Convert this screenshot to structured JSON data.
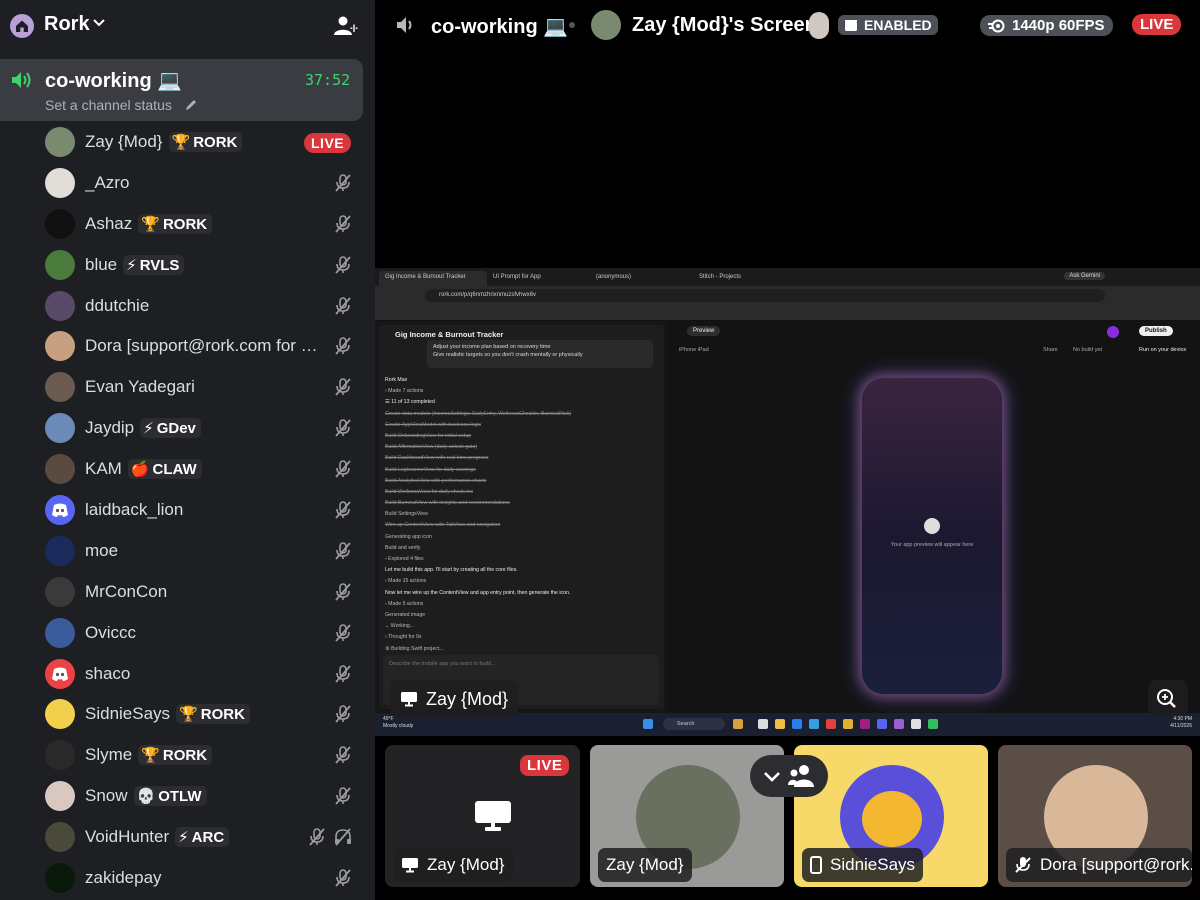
{
  "server": {
    "name": "Rork",
    "icon": "home-house-icon"
  },
  "voice_channel": {
    "name": "co-working 💻",
    "timer": "37:52",
    "status_placeholder": "Set a channel status"
  },
  "members": [
    {
      "name": "Zay {Mod}",
      "tag_icon": "🏆",
      "tag": "RORK",
      "live": "LIVE",
      "avatar_color": "#7a8a70"
    },
    {
      "name": "_Azro",
      "tag_icon": "",
      "tag": "",
      "avatar_color": "#e0ddd6"
    },
    {
      "name": "Ashaz",
      "tag_icon": "🏆",
      "tag": "RORK",
      "avatar_color": "#111111"
    },
    {
      "name": "blue",
      "tag_icon": "⚡",
      "tag": "RVLS",
      "avatar_color": "#4a7a3c"
    },
    {
      "name": "ddutchie",
      "tag_icon": "",
      "tag": "",
      "avatar_color": "#5a4a6a"
    },
    {
      "name": "Dora [support@rork.com for help]",
      "tag_icon": "",
      "tag": "",
      "avatar_color": "#c8a080"
    },
    {
      "name": "Evan Yadegari",
      "tag_icon": "",
      "tag": "",
      "avatar_color": "#6a5a50"
    },
    {
      "name": "Jaydip",
      "tag_icon": "⚡",
      "tag": "GDev",
      "avatar_color": "#6a8ab8"
    },
    {
      "name": "KAM",
      "tag_icon": "🍎",
      "tag": "CLAW",
      "avatar_color": "#5a4a40"
    },
    {
      "name": "laidback_lion",
      "tag_icon": "",
      "tag": "",
      "avatar_color": "#5865f2",
      "default_avatar": true
    },
    {
      "name": "moe",
      "tag_icon": "",
      "tag": "",
      "avatar_color": "#1a2a5a"
    },
    {
      "name": "MrConCon",
      "tag_icon": "",
      "tag": "",
      "avatar_color": "#3a3a3a"
    },
    {
      "name": "Oviccc",
      "tag_icon": "",
      "tag": "",
      "avatar_color": "#3a5a9a"
    },
    {
      "name": "shaco",
      "tag_icon": "",
      "tag": "",
      "avatar_color": "#ed4245",
      "default_avatar": true
    },
    {
      "name": "SidnieSays",
      "tag_icon": "🏆",
      "tag": "RORK",
      "avatar_color": "#f2d04c"
    },
    {
      "name": "Slyme",
      "tag_icon": "🏆",
      "tag": "RORK",
      "avatar_color": "#2a2a2a"
    },
    {
      "name": "Snow",
      "tag_icon": "💀",
      "tag": "OTLW",
      "avatar_color": "#d8c8c0"
    },
    {
      "name": "VoidHunter",
      "tag_icon": "⚡",
      "tag": "ARC",
      "avatar_color": "#4a4a3a",
      "deafened": true
    },
    {
      "name": "zakidepay",
      "tag_icon": "",
      "tag": "",
      "avatar_color": "#0a1a0a"
    }
  ],
  "topbar": {
    "channel": "co-working 💻",
    "screen_title": "Zay {Mod}'s Screen",
    "enabled_label": "ENABLED",
    "quality": "1440p 60FPS",
    "live": "LIVE"
  },
  "stream": {
    "browser_tabs": [
      "Gig Income & Burnout Tracker",
      "UI Prompt for App",
      "(anonymous)",
      "Stitch - Projects"
    ],
    "ask": "Ask Gemini",
    "url": "rork.com/p/q6nmzhrixnmuzsfvhwx6v",
    "project_title": "Gig Income & Burnout Tracker",
    "chat_msg": [
      "Adjust your income plan based on recovery time",
      "Give realistic targets so you don't crash mentally or physically"
    ],
    "chat_lines": [
      {
        "t": "Rork Max",
        "s": "b"
      },
      {
        "t": "› Made 7 actions",
        "s": ""
      },
      {
        "t": "☰ 11 of 13 completed",
        "s": "b"
      },
      {
        "t": "Create data models (IncomeSettings, DailyEntry, WellnessCheckIn, BurnoutRisk)",
        "s": "done"
      },
      {
        "t": "Create AppViewModel with business logic",
        "s": "done"
      },
      {
        "t": "Build OnboardingView for initial setup",
        "s": "done"
      },
      {
        "t": "Build AffirmationView (daily unlock gate)",
        "s": "done"
      },
      {
        "t": "Build DashboardView with real-time progress",
        "s": "done"
      },
      {
        "t": "Build LogIncomeView for daily earnings",
        "s": "done"
      },
      {
        "t": "Build AnalyticsView with performance charts",
        "s": "done"
      },
      {
        "t": "Build WellnessView for daily check-ins",
        "s": "done"
      },
      {
        "t": "Build BurnoutView with insights and recommendations",
        "s": "done"
      },
      {
        "t": "Build SettingsView",
        "s": ""
      },
      {
        "t": "Wire up ContentView with TabView and navigation",
        "s": "done"
      },
      {
        "t": "Generating app icon",
        "s": ""
      },
      {
        "t": "Build and verify",
        "s": ""
      },
      {
        "t": "› Explored 4 files",
        "s": ""
      },
      {
        "t": "Let me build this app. I'll start by creating all the core files.",
        "s": "b"
      },
      {
        "t": "› Made 15 actions",
        "s": ""
      },
      {
        "t": "Now let me wire up the ContentView and app entry point, then generate the icon.",
        "s": "b"
      },
      {
        "t": "› Made 5 actions",
        "s": ""
      },
      {
        "t": "Generated image",
        "s": ""
      },
      {
        "t": "⌄ Working...",
        "s": ""
      },
      {
        "t": "   › Thought for 0s",
        "s": ""
      },
      {
        "t": "   ⚙ Building Swift project...",
        "s": ""
      }
    ],
    "chat_input_placeholder": "Describe the mobile app you want to build...",
    "preview_tab": "Preview",
    "publish": "Publish",
    "device_tabs": "iPhone   iPad",
    "share": "Share",
    "no_build": "No build yet",
    "run_device": "Run on your device",
    "preview_text": "Your app preview will appear here",
    "weather": [
      "49°F",
      "Mostly cloudy"
    ],
    "search": "Search",
    "clock": [
      "4:30 PM",
      "4/11/2026"
    ]
  },
  "main_overlay_name": "Zay {Mod}",
  "tiles": [
    {
      "name": "Zay {Mod}",
      "icon": "screen-icon",
      "live": "LIVE",
      "bg": "#2a2a2a"
    },
    {
      "name": "Zay {Mod}",
      "icon": "",
      "bg": "#9a9a98"
    },
    {
      "name": "SidnieSays",
      "icon": "phone-icon",
      "bg": "#f7d96a"
    },
    {
      "name": "Dora [support@rork.com for help]",
      "icon": "mic-muted-icon",
      "bg": "#5a4e46"
    }
  ]
}
